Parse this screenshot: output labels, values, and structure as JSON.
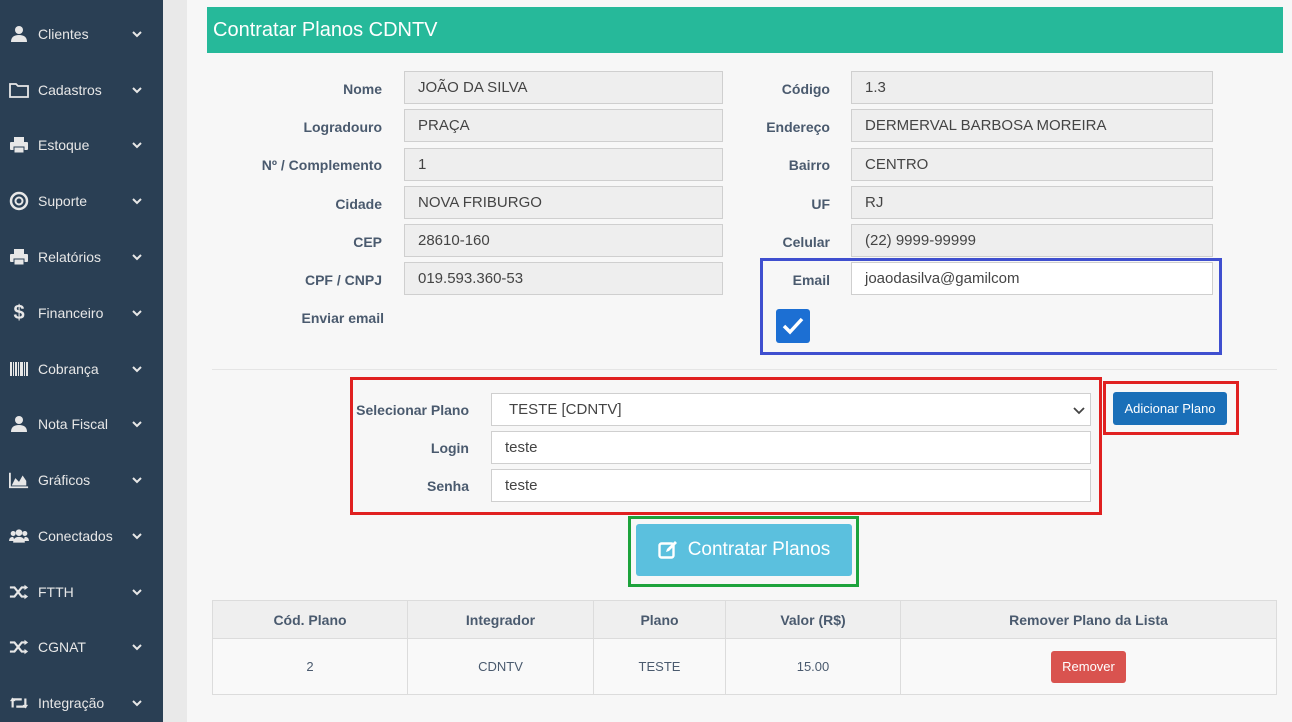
{
  "sidebar": {
    "items": [
      {
        "label": "Clientes",
        "icon": "user-icon"
      },
      {
        "label": "Cadastros",
        "icon": "folder-icon"
      },
      {
        "label": "Estoque",
        "icon": "printer-icon"
      },
      {
        "label": "Suporte",
        "icon": "lifebuoy-icon"
      },
      {
        "label": "Relatórios",
        "icon": "printer-icon"
      },
      {
        "label": "Financeiro",
        "icon": "dollar-icon"
      },
      {
        "label": "Cobrança",
        "icon": "barcode-icon"
      },
      {
        "label": "Nota Fiscal",
        "icon": "user-icon"
      },
      {
        "label": "Gráficos",
        "icon": "area-chart-icon"
      },
      {
        "label": "Conectados",
        "icon": "users-icon"
      },
      {
        "label": "FTTH",
        "icon": "random-icon"
      },
      {
        "label": "CGNAT",
        "icon": "random-icon"
      },
      {
        "label": "Integração",
        "icon": "retweet-icon"
      }
    ]
  },
  "header": {
    "title": "Contratar Planos CDNTV"
  },
  "form": {
    "nome_label": "Nome",
    "nome": "JOÃO DA SILVA",
    "logradouro_label": "Logradouro",
    "logradouro": "PRAÇA",
    "numero_label": "Nº / Complemento",
    "numero": "1",
    "cidade_label": "Cidade",
    "cidade": "NOVA FRIBURGO",
    "cep_label": "CEP",
    "cep": "28610-160",
    "cpf_label": "CPF / CNPJ",
    "cpf": "019.593.360-53",
    "enviar_email_label": "Enviar email",
    "codigo_label": "Código",
    "codigo": "1.3",
    "endereco_label": "Endereço",
    "endereco": "DERMERVAL BARBOSA MOREIRA",
    "bairro_label": "Bairro",
    "bairro": "CENTRO",
    "uf_label": "UF",
    "uf": "RJ",
    "celular_label": "Celular",
    "celular": "(22) 9999-99999",
    "email_label": "Email",
    "email": "joaodasilva@gamilcom",
    "enviar_email_checked": true
  },
  "plan": {
    "select_label": "Selecionar Plano",
    "selected": "TESTE [CDNTV]",
    "login_label": "Login",
    "login": "teste",
    "senha_label": "Senha",
    "senha": "teste",
    "add_button": "Adicionar Plano",
    "contract_button": "Contratar Planos"
  },
  "table": {
    "headers": [
      "Cód. Plano",
      "Integrador",
      "Plano",
      "Valor (R$)",
      "Remover Plano da Lista"
    ],
    "rows": [
      {
        "codigo": "2",
        "integrador": "CDNTV",
        "plano": "TESTE",
        "valor": "15.00",
        "remove": "Remover"
      }
    ]
  },
  "colors": {
    "header": "#26b99a",
    "sidebar": "#2a3f54",
    "primary": "#1a6fb8",
    "info": "#5bc0de",
    "danger": "#d9534f"
  }
}
